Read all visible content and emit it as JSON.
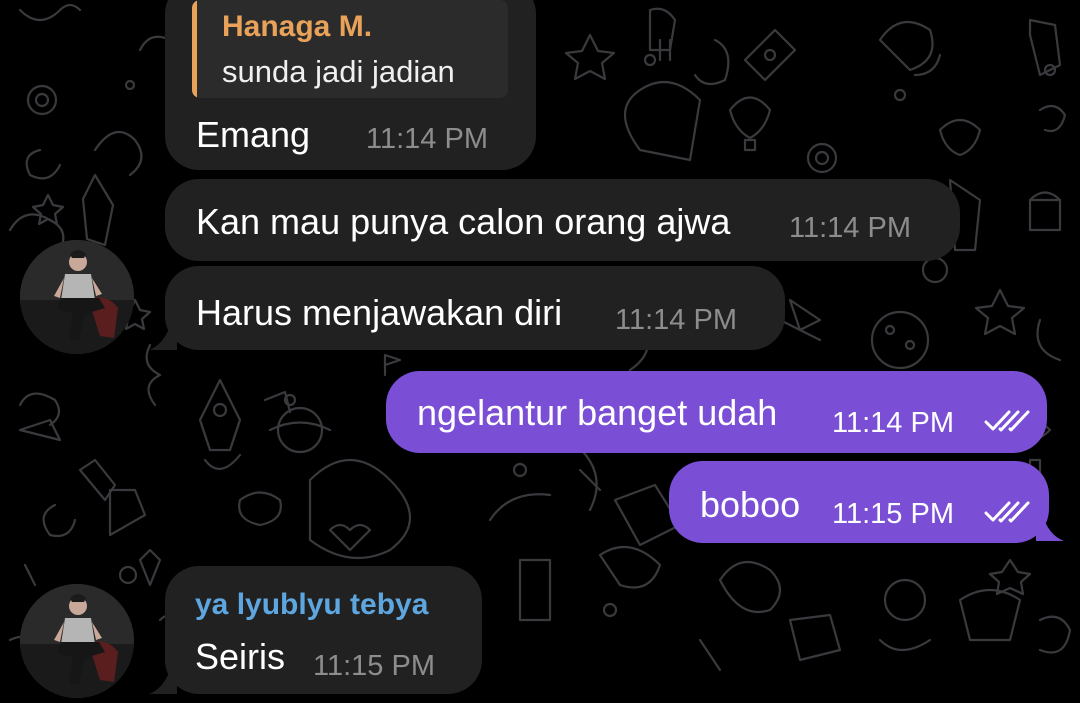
{
  "theme": {
    "background": "#000000",
    "incoming_bubble": "#212121",
    "outgoing_bubble": "#7a4fd6",
    "reply_accent": "#e9a25a",
    "sender_name_color": "#5ea6e0",
    "read_check_color": "#ffffff"
  },
  "messages": [
    {
      "direction": "incoming",
      "reply": {
        "author": "Hanaga M.",
        "text": "sunda jadi jadian"
      },
      "text": "Emang",
      "time": "11:14 PM"
    },
    {
      "direction": "incoming",
      "text": "Kan mau punya calon orang ajwa",
      "time": "11:14 PM"
    },
    {
      "direction": "incoming",
      "text": "Harus menjawakan diri",
      "time": "11:14 PM",
      "avatar_icon": "person-seated-avatar-icon"
    },
    {
      "direction": "outgoing",
      "text": "ngelantur banget udah",
      "time": "11:14 PM",
      "status_icon": "double-check-icon"
    },
    {
      "direction": "outgoing",
      "text": "boboo",
      "time": "11:15 PM",
      "status_icon": "double-check-icon"
    },
    {
      "direction": "incoming",
      "sender": "ya lyublyu tebya",
      "text": "Seiris",
      "time": "11:15 PM",
      "avatar_icon": "person-seated-avatar-icon"
    }
  ]
}
